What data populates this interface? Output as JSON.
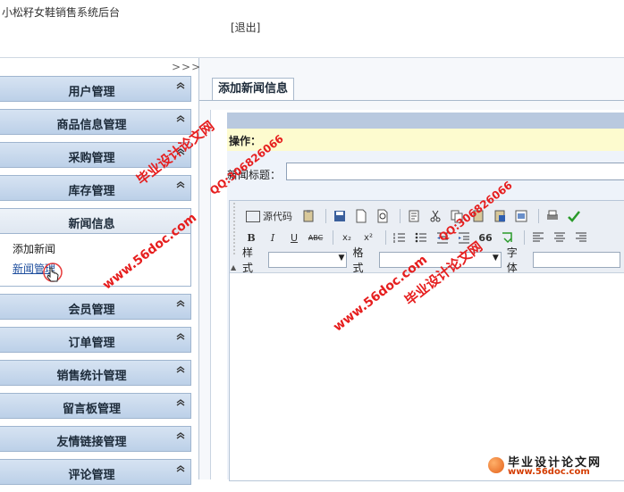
{
  "header": {
    "app_title": "小松籽女鞋销售系统后台",
    "logout": "[退出]"
  },
  "sidebar": {
    "collapse_label": ">>>",
    "items_before": [
      {
        "label": "用户管理"
      },
      {
        "label": "商品信息管理"
      },
      {
        "label": "采购管理"
      },
      {
        "label": "库存管理"
      }
    ],
    "open_item": {
      "label": "新闻信息",
      "children": [
        "添加新闻",
        "新闻管理"
      ]
    },
    "items_after": [
      {
        "label": "会员管理"
      },
      {
        "label": "订单管理"
      },
      {
        "label": "销售统计管理"
      },
      {
        "label": "留言板管理"
      },
      {
        "label": "友情链接管理"
      },
      {
        "label": "评论管理"
      }
    ],
    "chevron": "⌃"
  },
  "main": {
    "tab_label": "添加新闻信息",
    "ops_label": "操作：",
    "title_label": "新闻标题：",
    "title_value": ""
  },
  "editor": {
    "source_button": "源代码",
    "style_label": "样式",
    "format_label": "格式",
    "font_label": "字体",
    "bold": "B",
    "italic": "I",
    "underline": "U",
    "strike": "ABC",
    "subscript": "x₂",
    "superscript": "x²",
    "quote": "66"
  },
  "watermarks": {
    "site": "毕业设计论文网",
    "url": "www.56doc.com",
    "qq": "QQ:306826066"
  },
  "footer_logo": {
    "name": "毕业设计论文网",
    "url": "www.56doc.com"
  }
}
